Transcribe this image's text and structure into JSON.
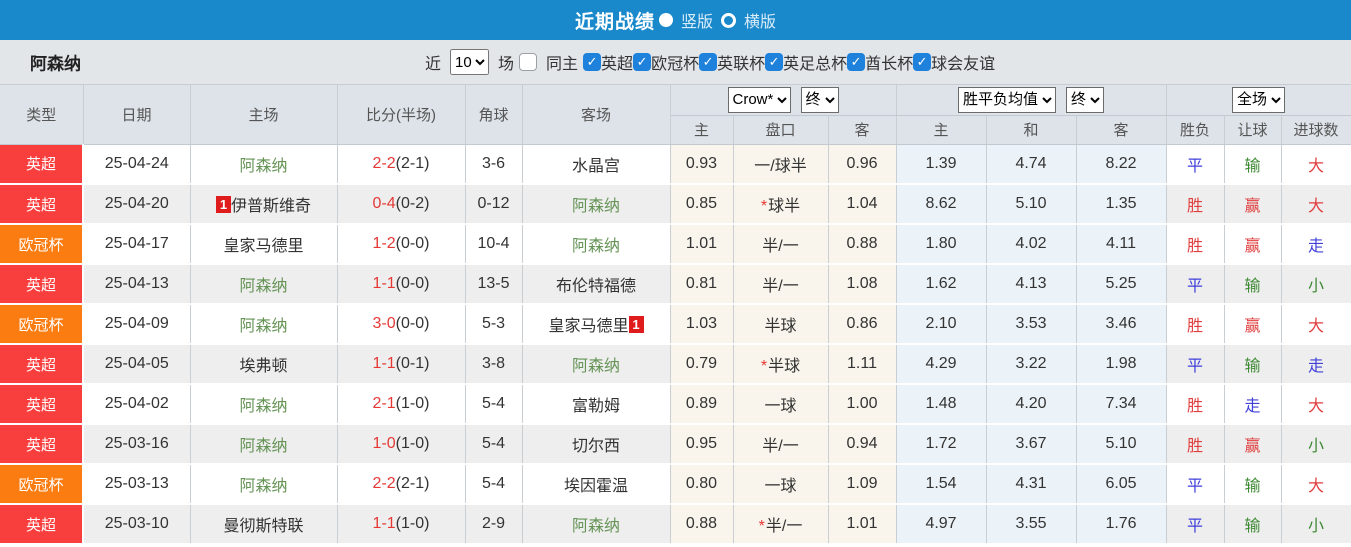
{
  "topbar": {
    "title": "近期战绩",
    "radio_selected_label": "竖版",
    "radio_unselected_label": "横版"
  },
  "filterbar": {
    "team": "阿森纳",
    "near_label": "近",
    "count_value": "10",
    "games_label": "场",
    "same_home_label": "同主",
    "leagues": [
      "英超",
      "欧冠杯",
      "英联杯",
      "英足总杯",
      "酋长杯",
      "球会友谊"
    ]
  },
  "controls": {
    "odds_company": "Crow*",
    "odds_state": "终",
    "avg_label": "胜平负均值",
    "avg_state": "终",
    "scope": "全场"
  },
  "icons": {
    "check": "✓"
  },
  "colors": {
    "topbar_blue": "#1a89cb",
    "league_red": "#f93e3e",
    "league_orange": "#fb7c10",
    "team_green": "#669457",
    "score_red": "#e53935",
    "odds_beige": "#f9f5ec",
    "avg_blue": "#ecf3f8"
  },
  "table": {
    "headers": {
      "type": "类型",
      "date": "日期",
      "home": "主场",
      "score": "比分(半场)",
      "corner": "角球",
      "away": "客场",
      "odds_home": "主",
      "handicap": "盘口",
      "odds_away": "客",
      "avg_home": "主",
      "avg_draw": "和",
      "avg_away": "客",
      "result": "胜负",
      "let_result": "让球",
      "goals": "进球数"
    },
    "rows": [
      {
        "type": "英超",
        "type_class": "type-red",
        "date": "25-04-24",
        "home": "阿森纳",
        "home_class": "team-green",
        "home_card": "",
        "home_card_after": "",
        "score": "2-2",
        "half": "(2-1)",
        "corner": "3-6",
        "away": "水晶宫",
        "away_class": "",
        "away_card": "",
        "away_card_after": "",
        "odds_home": "0.93",
        "star": "",
        "handicap": "一/球半",
        "odds_away": "0.96",
        "avg_home": "1.39",
        "avg_draw": "4.74",
        "avg_away": "8.22",
        "result": "平",
        "result_class": "clr-blue",
        "let_result": "输",
        "let_class": "clr-green",
        "goals": "大",
        "goals_class": "clr-red"
      },
      {
        "type": "英超",
        "type_class": "type-red",
        "date": "25-04-20",
        "home": "伊普斯维奇",
        "home_class": "",
        "home_card": "1",
        "home_card_after": "",
        "score": "0-4",
        "half": "(0-2)",
        "corner": "0-12",
        "away": "阿森纳",
        "away_class": "team-green",
        "away_card": "",
        "away_card_after": "",
        "odds_home": "0.85",
        "star": "*",
        "handicap": "球半",
        "odds_away": "1.04",
        "avg_home": "8.62",
        "avg_draw": "5.10",
        "avg_away": "1.35",
        "result": "胜",
        "result_class": "clr-red",
        "let_result": "赢",
        "let_class": "clr-red",
        "goals": "大",
        "goals_class": "clr-red"
      },
      {
        "type": "欧冠杯",
        "type_class": "type-orange",
        "date": "25-04-17",
        "home": "皇家马德里",
        "home_class": "",
        "home_card": "",
        "home_card_after": "",
        "score": "1-2",
        "half": "(0-0)",
        "corner": "10-4",
        "away": "阿森纳",
        "away_class": "team-green",
        "away_card": "",
        "away_card_after": "",
        "odds_home": "1.01",
        "star": "",
        "handicap": "半/一",
        "odds_away": "0.88",
        "avg_home": "1.80",
        "avg_draw": "4.02",
        "avg_away": "4.11",
        "result": "胜",
        "result_class": "clr-red",
        "let_result": "赢",
        "let_class": "clr-red",
        "goals": "走",
        "goals_class": "clr-blue"
      },
      {
        "type": "英超",
        "type_class": "type-red",
        "date": "25-04-13",
        "home": "阿森纳",
        "home_class": "team-green",
        "home_card": "",
        "home_card_after": "",
        "score": "1-1",
        "half": "(0-0)",
        "corner": "13-5",
        "away": "布伦特福德",
        "away_class": "",
        "away_card": "",
        "away_card_after": "",
        "odds_home": "0.81",
        "star": "",
        "handicap": "半/一",
        "odds_away": "1.08",
        "avg_home": "1.62",
        "avg_draw": "4.13",
        "avg_away": "5.25",
        "result": "平",
        "result_class": "clr-blue",
        "let_result": "输",
        "let_class": "clr-green",
        "goals": "小",
        "goals_class": "clr-green"
      },
      {
        "type": "欧冠杯",
        "type_class": "type-orange",
        "date": "25-04-09",
        "home": "阿森纳",
        "home_class": "team-green",
        "home_card": "",
        "home_card_after": "",
        "score": "3-0",
        "half": "(0-0)",
        "corner": "5-3",
        "away": "皇家马德里",
        "away_class": "",
        "away_card": "",
        "away_card_after": "1",
        "odds_home": "1.03",
        "star": "",
        "handicap": "半球",
        "odds_away": "0.86",
        "avg_home": "2.10",
        "avg_draw": "3.53",
        "avg_away": "3.46",
        "result": "胜",
        "result_class": "clr-red",
        "let_result": "赢",
        "let_class": "clr-red",
        "goals": "大",
        "goals_class": "clr-red"
      },
      {
        "type": "英超",
        "type_class": "type-red",
        "date": "25-04-05",
        "home": "埃弗顿",
        "home_class": "",
        "home_card": "",
        "home_card_after": "",
        "score": "1-1",
        "half": "(0-1)",
        "corner": "3-8",
        "away": "阿森纳",
        "away_class": "team-green",
        "away_card": "",
        "away_card_after": "",
        "odds_home": "0.79",
        "star": "*",
        "handicap": "半球",
        "odds_away": "1.11",
        "avg_home": "4.29",
        "avg_draw": "3.22",
        "avg_away": "1.98",
        "result": "平",
        "result_class": "clr-blue",
        "let_result": "输",
        "let_class": "clr-green",
        "goals": "走",
        "goals_class": "clr-blue"
      },
      {
        "type": "英超",
        "type_class": "type-red",
        "date": "25-04-02",
        "home": "阿森纳",
        "home_class": "team-green",
        "home_card": "",
        "home_card_after": "",
        "score": "2-1",
        "half": "(1-0)",
        "corner": "5-4",
        "away": "富勒姆",
        "away_class": "",
        "away_card": "",
        "away_card_after": "",
        "odds_home": "0.89",
        "star": "",
        "handicap": "一球",
        "odds_away": "1.00",
        "avg_home": "1.48",
        "avg_draw": "4.20",
        "avg_away": "7.34",
        "result": "胜",
        "result_class": "clr-red",
        "let_result": "走",
        "let_class": "clr-blue",
        "goals": "大",
        "goals_class": "clr-red"
      },
      {
        "type": "英超",
        "type_class": "type-red",
        "date": "25-03-16",
        "home": "阿森纳",
        "home_class": "team-green",
        "home_card": "",
        "home_card_after": "",
        "score": "1-0",
        "half": "(1-0)",
        "corner": "5-4",
        "away": "切尔西",
        "away_class": "",
        "away_card": "",
        "away_card_after": "",
        "odds_home": "0.95",
        "star": "",
        "handicap": "半/一",
        "odds_away": "0.94",
        "avg_home": "1.72",
        "avg_draw": "3.67",
        "avg_away": "5.10",
        "result": "胜",
        "result_class": "clr-red",
        "let_result": "赢",
        "let_class": "clr-red",
        "goals": "小",
        "goals_class": "clr-green"
      },
      {
        "type": "欧冠杯",
        "type_class": "type-orange",
        "date": "25-03-13",
        "home": "阿森纳",
        "home_class": "team-green",
        "home_card": "",
        "home_card_after": "",
        "score": "2-2",
        "half": "(2-1)",
        "corner": "5-4",
        "away": "埃因霍温",
        "away_class": "",
        "away_card": "",
        "away_card_after": "",
        "odds_home": "0.80",
        "star": "",
        "handicap": "一球",
        "odds_away": "1.09",
        "avg_home": "1.54",
        "avg_draw": "4.31",
        "avg_away": "6.05",
        "result": "平",
        "result_class": "clr-blue",
        "let_result": "输",
        "let_class": "clr-green",
        "goals": "大",
        "goals_class": "clr-red"
      },
      {
        "type": "英超",
        "type_class": "type-red",
        "date": "25-03-10",
        "home": "曼彻斯特联",
        "home_class": "",
        "home_card": "",
        "home_card_after": "",
        "score": "1-1",
        "half": "(1-0)",
        "corner": "2-9",
        "away": "阿森纳",
        "away_class": "team-green",
        "away_card": "",
        "away_card_after": "",
        "odds_home": "0.88",
        "star": "*",
        "handicap": "半/一",
        "odds_away": "1.01",
        "avg_home": "4.97",
        "avg_draw": "3.55",
        "avg_away": "1.76",
        "result": "平",
        "result_class": "clr-blue",
        "let_result": "输",
        "let_class": "clr-green",
        "goals": "小",
        "goals_class": "clr-green"
      }
    ]
  }
}
